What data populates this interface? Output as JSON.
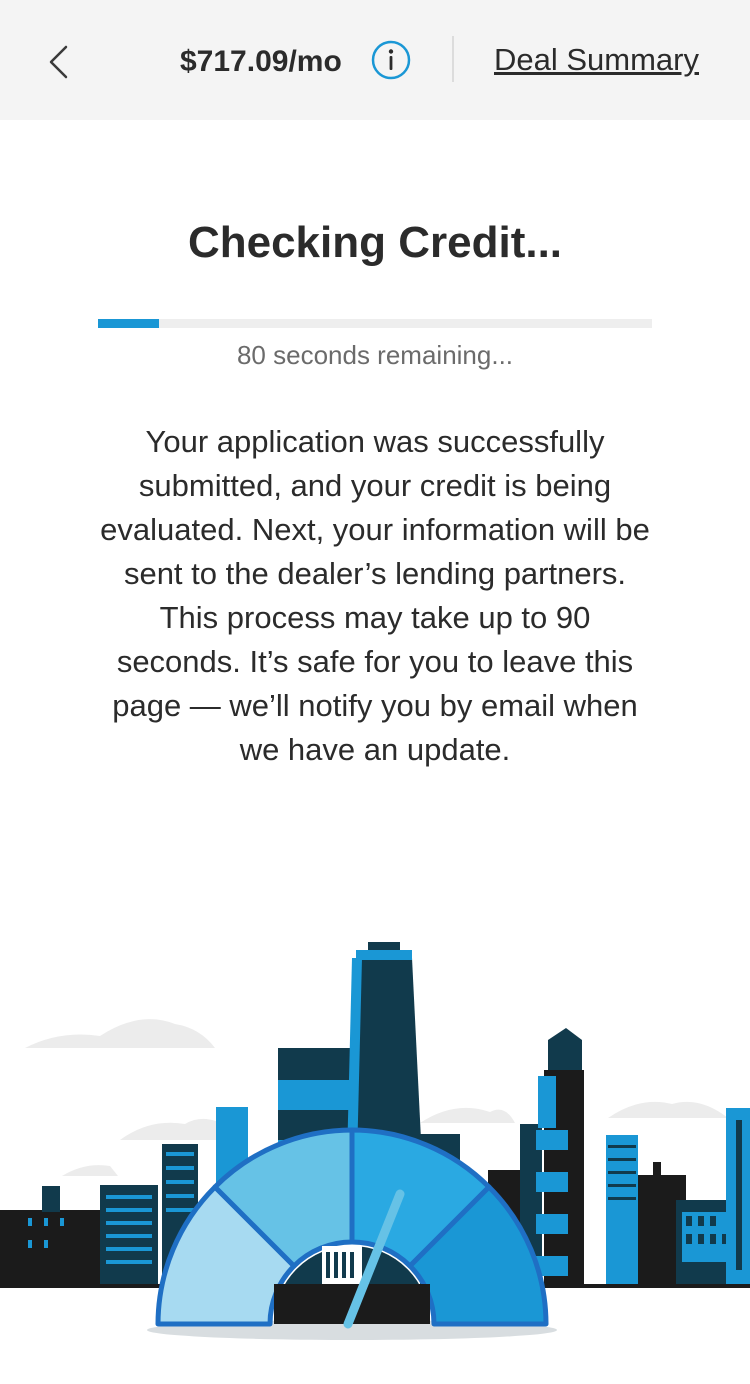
{
  "header": {
    "back_icon": "chevron-left-icon",
    "price": "$717.09/mo",
    "info_icon": "info-circle-icon",
    "deal_summary_label": "Deal Summary"
  },
  "main": {
    "title": "Checking Credit...",
    "progress_fraction": 0.11,
    "remaining_text": "80 seconds remaining...",
    "message": "Your application was successfully submitted, and your credit is being evaluated. Next, your information will be sent to the dealer’s lending partners. This process may take up to 90 seconds. It’s safe for you to leave this page — we’ll notify you by email when we have an update."
  },
  "colors": {
    "accent": "#1a97d5",
    "dark_navy": "#113a4c",
    "light_blue": "#a7daf1",
    "mid_blue": "#66c2e6",
    "gauge_outline": "#1f6fc4",
    "skyline_black": "#1b1b1b",
    "cloud": "#ececec"
  },
  "illustration": {
    "name": "credit-gauge-cityscape"
  }
}
